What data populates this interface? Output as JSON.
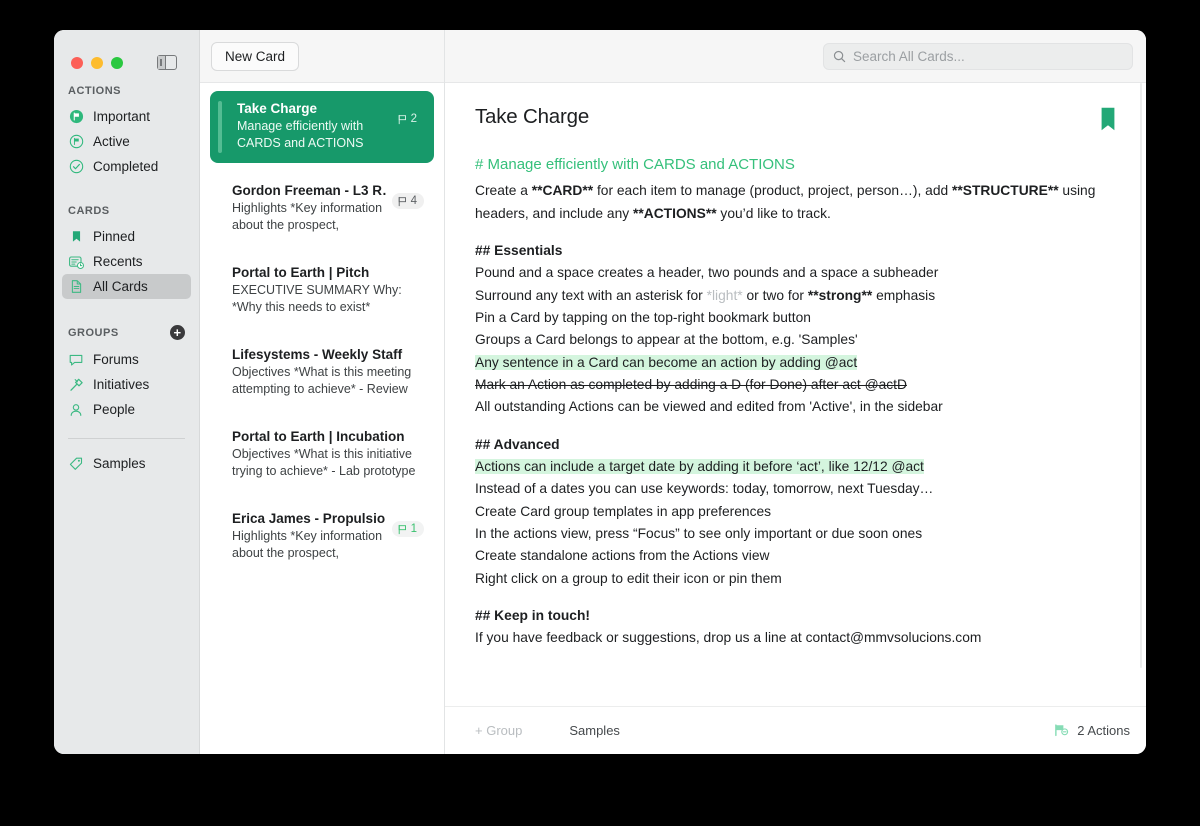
{
  "window": {
    "traffic_lights": [
      "close",
      "minimize",
      "zoom"
    ],
    "sidebar_toggle_icon": "sidebar-toggle-icon"
  },
  "sidebar": {
    "sections": [
      {
        "title": "ACTIONS",
        "items": [
          {
            "label": "Important",
            "icon": "flag-filled-circle-icon",
            "active": false
          },
          {
            "label": "Active",
            "icon": "flag-outline-circle-icon",
            "active": false
          },
          {
            "label": "Completed",
            "icon": "check-circle-icon",
            "active": false
          }
        ]
      },
      {
        "title": "CARDS",
        "items": [
          {
            "label": "Pinned",
            "icon": "bookmark-icon",
            "active": false
          },
          {
            "label": "Recents",
            "icon": "recents-clock-card-icon",
            "active": false
          },
          {
            "label": "All Cards",
            "icon": "document-icon",
            "active": true
          }
        ]
      },
      {
        "title": "GROUPS",
        "add_button": "+",
        "items": [
          {
            "label": "Forums",
            "icon": "speech-bubble-icon",
            "active": false
          },
          {
            "label": "Initiatives",
            "icon": "hammer-icon",
            "active": false
          },
          {
            "label": "People",
            "icon": "person-icon",
            "active": false
          }
        ]
      }
    ],
    "footer_items": [
      {
        "label": "Samples",
        "icon": "tag-icon",
        "active": false
      }
    ]
  },
  "list_toolbar": {
    "new_card_label": "New Card"
  },
  "search": {
    "placeholder": "Search All Cards...",
    "icon": "search-icon",
    "value": ""
  },
  "card_list": [
    {
      "title": "Take Charge",
      "snippet": "Manage efficiently with CARDS and ACTIONS Creat…",
      "badge_count": "2",
      "badge_style": "on-green",
      "selected": true
    },
    {
      "title": "Gordon Freeman - L3 R…",
      "snippet": "Highlights *Key information about the prospect, relevant…",
      "badge_count": "4",
      "badge_style": "grey",
      "selected": false
    },
    {
      "title": "Portal to Earth | Pitch",
      "snippet": "EXECUTIVE SUMMARY   Why: *Why this needs to exist* Establishing a fa…",
      "badge_count": "",
      "badge_style": "none",
      "selected": false
    },
    {
      "title": "Lifesystems - Weekly Staff",
      "snippet": "Objectives *What is this meeting attempting to achieve* - Review and…",
      "badge_count": "",
      "badge_style": "none",
      "selected": false
    },
    {
      "title": "Portal to Earth | Incubation",
      "snippet": "Objectives *What is this initiative trying to achieve* - Lab prototype v…",
      "badge_count": "",
      "badge_style": "none",
      "selected": false
    },
    {
      "title": "Erica James - Propulsio…",
      "snippet": "Highlights *Key information about the prospect, relevant c…",
      "badge_count": "1",
      "badge_style": "green-count",
      "selected": false
    }
  ],
  "detail": {
    "title": "Take Charge",
    "bookmark_icon": "bookmark-filled-icon",
    "heading": "# Manage efficiently with CARDS and ACTIONS",
    "intro": {
      "part1": "Create a ",
      "bold1": "**CARD**",
      "part2": " for each item to manage (product, project, person…), add ",
      "bold2": "**STRUCTURE**",
      "part3": " using headers, and include any ",
      "bold3": "**ACTIONS**",
      "part4": " you’d like to track."
    },
    "essentials": {
      "heading": "## Essentials",
      "lines": [
        "Pound and a space creates a header, two pounds and a space a subheader",
        "Pin a Card by tapping on the top-right bookmark button",
        "Groups a Card belongs to appear at the bottom, e.g. 'Samples'",
        "Any sentence in a Card can become an action by adding @act",
        "Mark an Action as completed by adding a D (for Done) after act @actD",
        "All outstanding Actions can be viewed and edited from 'Active', in the sidebar"
      ],
      "emphasis_line": {
        "a": "Surround any text with an asterisk for ",
        "light": "*light*",
        "b": " or two for ",
        "strong": "**strong**",
        "c": " emphasis"
      }
    },
    "advanced": {
      "heading": "## Advanced",
      "lines": [
        "Actions can include a target date by adding it before ‘act’, like 12/12 @act",
        "Instead of a dates you can use keywords: today, tomorrow, next Tuesday…",
        "Create Card group templates in app preferences",
        "In the actions view,  press “Focus” to see only important or due soon ones",
        "Create standalone actions from the Actions view",
        "Right click on a group to edit their icon or pin them"
      ]
    },
    "keep_in_touch": {
      "heading": "## Keep in touch!",
      "line": "If you have feedback or suggestions, drop us a line at contact@mmvsolucions.com"
    }
  },
  "detail_footer": {
    "add_group_label": "+ Group",
    "group_label": "Samples",
    "actions_label": "2 Actions",
    "actions_icon": "flags-icon"
  },
  "colors": {
    "accent_green": "#17996a",
    "heading_green": "#35c07b",
    "highlight_green": "#d4f5de",
    "sidebar_bg": "#e7e9ea",
    "icon_green": "#3cb983"
  }
}
